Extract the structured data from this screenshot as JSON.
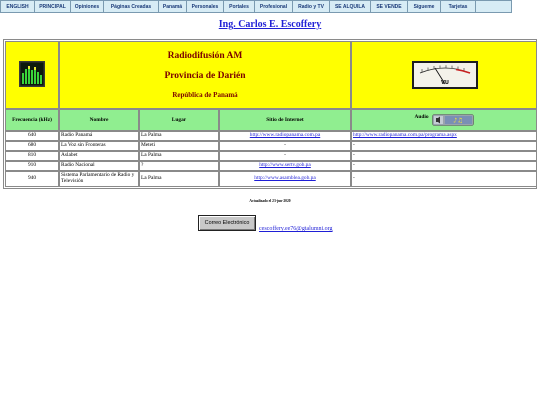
{
  "nav": [
    "ENGLISH",
    "PRINCIPAL",
    "Opiniones",
    "Páginas Creadas",
    "Panamá",
    "Personales",
    "Portales",
    "Profesional",
    "Radio y TV",
    "SE ALQUILA",
    "SE VENDE",
    "Sígueme",
    "Tarjetas"
  ],
  "header_link": "Ing. Carlos E. Escoffery",
  "banner": {
    "line1": "Radiodifusión AM",
    "line2": "Provincia de Darién",
    "line3": "República de Panamá",
    "vu_label": "VU"
  },
  "columns": {
    "freq": "Frecuencia (kHz)",
    "name": "Nombre",
    "place": "Lugar",
    "site": "Sitio de Internet",
    "audio": "Audio"
  },
  "rows": [
    {
      "freq": "640",
      "name": "Radio Panamá",
      "place": "La Palma",
      "site": "http://www.radiopanama.com.pa",
      "audio": "http://www.radiopanama.com.pa/programa.aspx"
    },
    {
      "freq": "680",
      "name": "La Voz sin Fronteras",
      "place": "Meteti",
      "site": "-",
      "audio": "-"
    },
    {
      "freq": "810",
      "name": "Aslabet",
      "place": "La Palma",
      "site": "-",
      "audio": "-"
    },
    {
      "freq": "910",
      "name": "Radio Nacional",
      "place": "?",
      "site": "http://www.sertv.gob.pa",
      "audio": "-"
    },
    {
      "freq": "940",
      "name": "Sistema Parlamentario de Radio y Televisión",
      "place": "La Palma",
      "site": "http://www.asamblea.gob.pa",
      "audio": "-"
    }
  ],
  "updated": "Actualizado el 23-jun-2020",
  "email_button": "Correo Electrónico",
  "email_link": "cescoffery.ee76@gtalumni.org",
  "colors": {
    "yellow": "#ffff00",
    "green": "#90ee90",
    "link": "#1f1fd6",
    "title": "#7a0000",
    "nav_bg": "#d7ecf5"
  }
}
